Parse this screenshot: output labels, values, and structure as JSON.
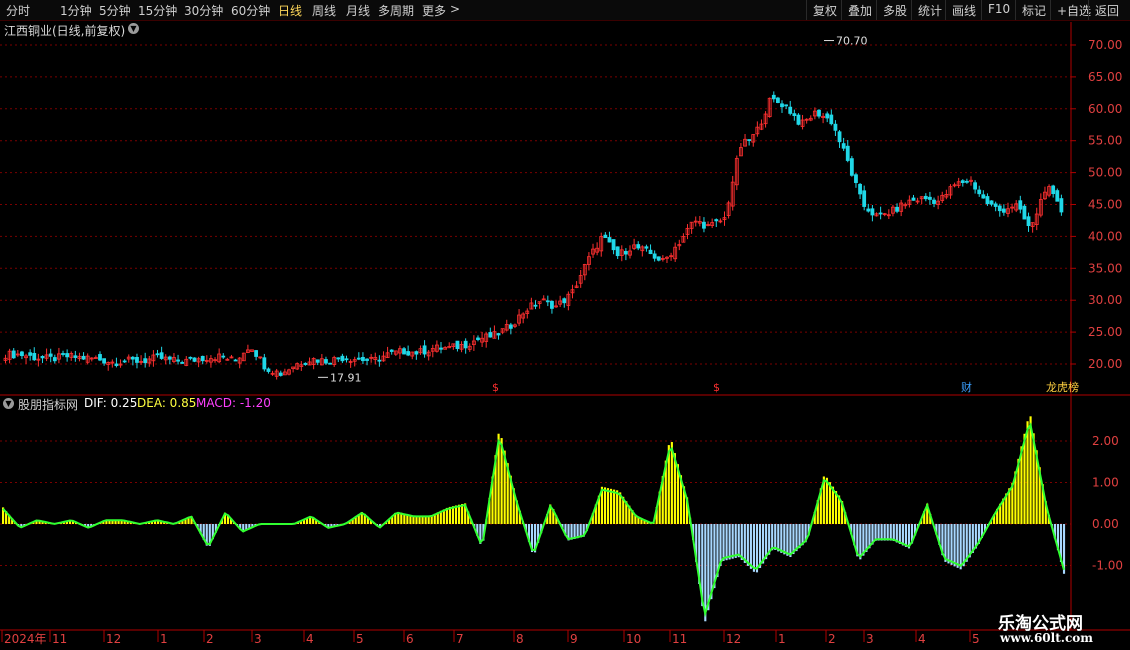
{
  "toolbar": {
    "periods": [
      "分时",
      "1分钟",
      "5分钟",
      "15分钟",
      "30分钟",
      "60分钟",
      "日线",
      "周线",
      "月线",
      "多周期",
      "更多"
    ],
    "active_period": "日线",
    "more_arrow": ">",
    "right_buttons": [
      "复权",
      "叠加",
      "多股",
      "统计",
      "画线",
      "F10",
      "标记",
      "+自选",
      "返回"
    ]
  },
  "price_panel": {
    "title": "江西铜业(日线,前复权)",
    "high_label": "70.70",
    "low_label": "17.91",
    "y_ticks": [
      "70.00",
      "65.00",
      "60.00",
      "55.00",
      "50.00",
      "45.00",
      "40.00",
      "35.00",
      "30.00",
      "25.00",
      "20.00"
    ],
    "markers": [
      {
        "text": "$",
        "color": "#ff3030"
      },
      {
        "text": "$",
        "color": "#ff3030"
      },
      {
        "text": "财",
        "color": "#3aa0ff"
      },
      {
        "text": "龙虎榜",
        "color": "#ffd040"
      }
    ]
  },
  "indicator_panel": {
    "name": "股朋指标网",
    "dif_label": "DIF: 0.25",
    "dea_label": "DEA: 0.85",
    "macd_label": "MACD: -1.20",
    "y_ticks": [
      "2.00",
      "1.00",
      "0.00",
      "-1.00"
    ]
  },
  "time_axis": {
    "labels": [
      "2024年",
      "11",
      "12",
      "1",
      "2",
      "3",
      "4",
      "5",
      "6",
      "7",
      "8",
      "9",
      "10",
      "11",
      "12",
      "1",
      "2",
      "3",
      "4",
      "5"
    ]
  },
  "watermark": {
    "line1": "乐淘公式网",
    "line2": "www.60lt.com"
  },
  "colors": {
    "up": "#ff3030",
    "down": "#20d8e8",
    "dif": "#ffffff",
    "dea": "#ffff00",
    "hist_pos": "#ffff00",
    "hist_neg": "#a8d8ff",
    "grid": "#7a0000",
    "axis": "#b00000",
    "green_line": "#30ff30"
  },
  "chart_data": [
    {
      "type": "candlestick",
      "title": "江西铜业(日线,前复权)",
      "ylim": [
        17,
        73
      ],
      "x": [
        "2023-10",
        "2023-11",
        "2023-12",
        "2024-01",
        "2024-02",
        "2024-03",
        "2024-04",
        "2024-05",
        "2024-06",
        "2024-07",
        "2024-08",
        "2024-09",
        "2024-10",
        "2024-11",
        "2024-12",
        "2025-01",
        "2025-02",
        "2025-03",
        "2025-04",
        "2025-05"
      ],
      "close_path": [
        21.5,
        21.5,
        21,
        20.8,
        21.2,
        21,
        20.8,
        20.3,
        20.5,
        20.5,
        21,
        20.5,
        20.5,
        21,
        21.2,
        20.5,
        23,
        19.5,
        18.5,
        20,
        20.8,
        20.5,
        21,
        20.8,
        20.5,
        21.5,
        22,
        21.8,
        22.5,
        22.5,
        23,
        24,
        24.5,
        26,
        28.5,
        30,
        29,
        31,
        36,
        40,
        37,
        38.5,
        37.5,
        36,
        39,
        42.5,
        41.5,
        42.8,
        54,
        56,
        61.5,
        60.5,
        57.5,
        59.5,
        58,
        52,
        45,
        43,
        44,
        45.5,
        46,
        45.5,
        48,
        49,
        45.5,
        44,
        45,
        41,
        48,
        44
      ],
      "high_label": 70.7,
      "low_label": 17.91
    },
    {
      "type": "macd",
      "name": "股朋指标网",
      "DIF": 0.25,
      "DEA": 0.85,
      "MACD": -1.2,
      "ylim": [
        -2.4,
        2.8
      ],
      "histogram": [
        0.4,
        -0.1,
        0.1,
        0.0,
        0.1,
        -0.1,
        0.1,
        0.1,
        0.0,
        0.1,
        0.0,
        0.2,
        -0.6,
        0.3,
        -0.2,
        0.0,
        0.0,
        0.0,
        0.2,
        -0.1,
        0.0,
        0.3,
        -0.1,
        0.3,
        0.2,
        0.2,
        0.4,
        0.5,
        -0.6,
        2.3,
        0.6,
        -0.8,
        0.5,
        -0.4,
        -0.3,
        0.9,
        0.8,
        0.2,
        0.0,
        2.1,
        0.6,
        -2.4,
        -0.9,
        -0.8,
        -1.2,
        -0.6,
        -0.8,
        -0.4,
        1.2,
        0.6,
        -0.9,
        -0.4,
        -0.4,
        -0.6,
        0.5,
        -0.9,
        -1.1,
        -0.5,
        0.3,
        1.0,
        2.7,
        0.4,
        -1.2
      ]
    }
  ]
}
